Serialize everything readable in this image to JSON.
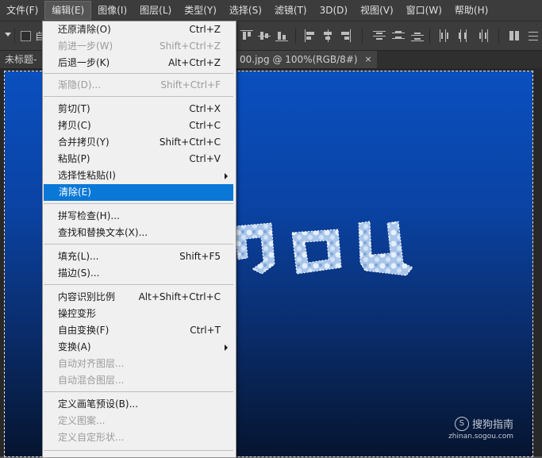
{
  "menubar": {
    "items": [
      "文件(F)",
      "编辑(E)",
      "图像(I)",
      "图层(L)",
      "类型(Y)",
      "选择(S)",
      "滤镜(T)",
      "3D(D)",
      "视图(V)",
      "窗口(W)",
      "帮助(H)"
    ],
    "active": "编辑(E)"
  },
  "options": {
    "auto_select_label": "自"
  },
  "tabs": {
    "left_label": "未标题-",
    "right_label": "00.jpg @ 100%(RGB/8#)",
    "close_glyph": "×"
  },
  "canvas": {
    "text": "you",
    "watermark_brand": "搜狗指南",
    "watermark_logo_glyph": "S",
    "watermark_url": "zhinan.sogou.com"
  },
  "edit_menu": {
    "items": [
      {
        "label": "还原清除(O)",
        "shortcut": "Ctrl+Z",
        "disabled": false
      },
      {
        "label": "前进一步(W)",
        "shortcut": "Shift+Ctrl+Z",
        "disabled": true
      },
      {
        "label": "后退一步(K)",
        "shortcut": "Alt+Ctrl+Z",
        "disabled": false
      },
      {
        "label": "渐隐(D)...",
        "shortcut": "Shift+Ctrl+F",
        "disabled": true
      },
      {
        "label": "剪切(T)",
        "shortcut": "Ctrl+X",
        "disabled": false
      },
      {
        "label": "拷贝(C)",
        "shortcut": "Ctrl+C",
        "disabled": false
      },
      {
        "label": "合并拷贝(Y)",
        "shortcut": "Shift+Ctrl+C",
        "disabled": false
      },
      {
        "label": "粘贴(P)",
        "shortcut": "Ctrl+V",
        "disabled": false
      },
      {
        "label": "选择性粘贴(I)",
        "shortcut": "",
        "disabled": false,
        "submenu": true
      },
      {
        "label": "清除(E)",
        "shortcut": "",
        "disabled": false,
        "highlighted": true
      },
      {
        "label": "拼写检查(H)...",
        "shortcut": "",
        "disabled": false
      },
      {
        "label": "查找和替换文本(X)...",
        "shortcut": "",
        "disabled": false
      },
      {
        "label": "填充(L)...",
        "shortcut": "Shift+F5",
        "disabled": false
      },
      {
        "label": "描边(S)...",
        "shortcut": "",
        "disabled": false
      },
      {
        "label": "内容识别比例",
        "shortcut": "Alt+Shift+Ctrl+C",
        "disabled": false
      },
      {
        "label": "操控变形",
        "shortcut": "",
        "disabled": false
      },
      {
        "label": "自由变换(F)",
        "shortcut": "Ctrl+T",
        "disabled": false
      },
      {
        "label": "变换(A)",
        "shortcut": "",
        "disabled": false,
        "submenu": true
      },
      {
        "label": "自动对齐图层...",
        "shortcut": "",
        "disabled": true
      },
      {
        "label": "自动混合图层...",
        "shortcut": "",
        "disabled": true
      },
      {
        "label": "定义画笔预设(B)...",
        "shortcut": "",
        "disabled": false
      },
      {
        "label": "定义图案...",
        "shortcut": "",
        "disabled": true
      },
      {
        "label": "定义自定形状...",
        "shortcut": "",
        "disabled": true
      }
    ]
  }
}
